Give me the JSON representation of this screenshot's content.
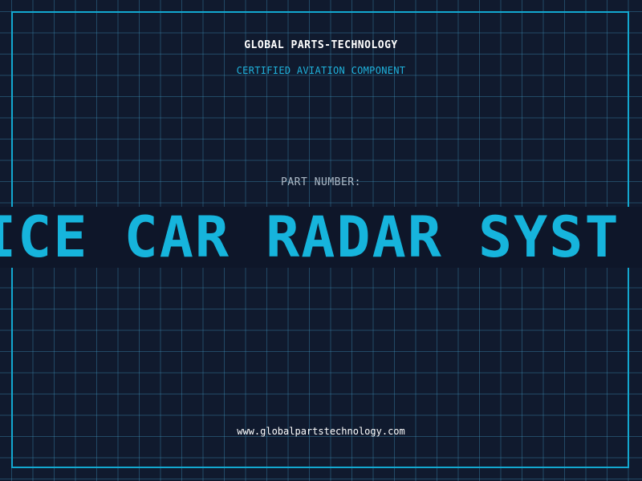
{
  "header": {
    "brand": "GLOBAL PARTS-TECHNOLOGY",
    "tagline": "CERTIFIED AVIATION COMPONENT"
  },
  "part": {
    "label": "PART NUMBER:",
    "value": "ICE CAR RADAR SYST"
  },
  "footer": {
    "url": "www.globalpartstechnology.com"
  },
  "colors": {
    "background": "#101a2e",
    "accent": "#16b4dc",
    "grid": "#2f6f8c",
    "text": "#ffffff"
  }
}
